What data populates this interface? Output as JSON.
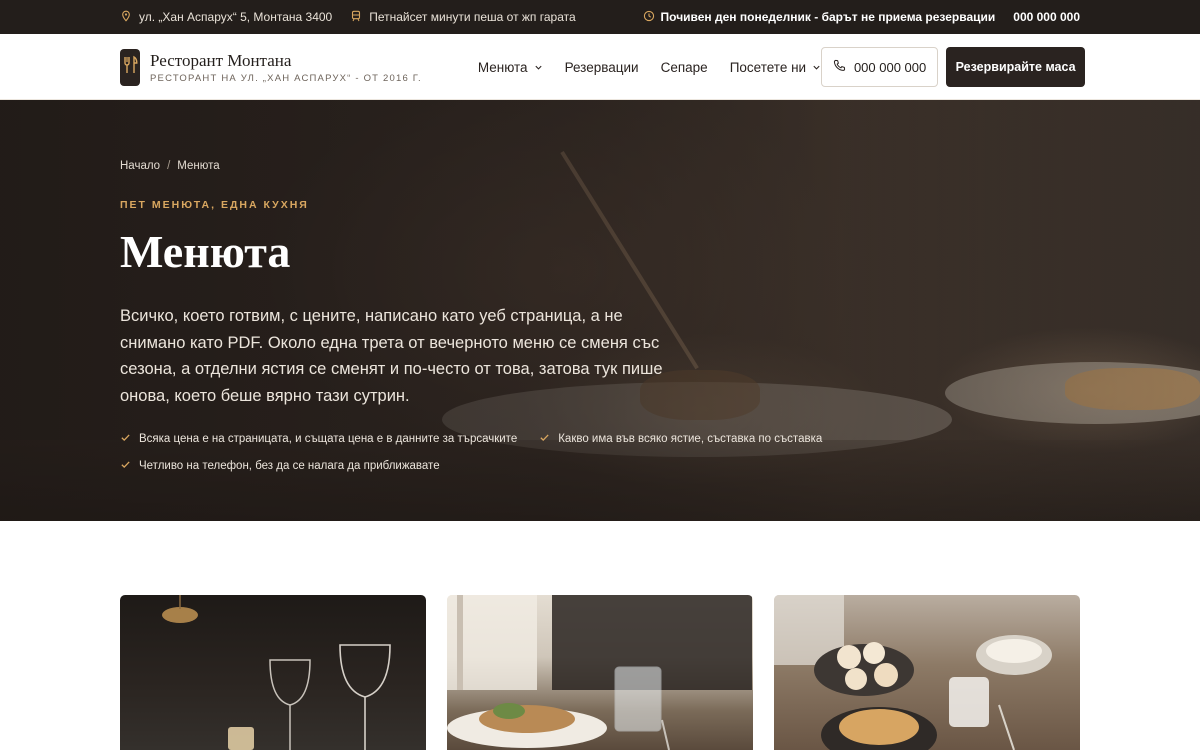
{
  "topbar": {
    "address": "ул. „Хан Аспарух“ 5, Монтана 3400",
    "walk": "Петнайсет минути пеша от жп гарата",
    "notice": "Почивен ден понеделник - барът не приема резервации",
    "phone": "000 000 000"
  },
  "header": {
    "brand_name": "Ресторант Монтана",
    "brand_sub": "РЕСТОРАНТ НА УЛ. „ХАН АСПАРУХ“ - ОТ 2016 Г.",
    "nav": [
      "Менюта",
      "Резервации",
      "Сепаре",
      "Посетете ни"
    ],
    "phone_button": "000 000 000",
    "reserve_button": "Резервирайте маса"
  },
  "hero": {
    "breadcrumb": [
      "Начало",
      "/",
      "Менюта"
    ],
    "eyebrow": "ПЕТ МЕНЮТА, ЕДНА КУХНЯ",
    "title": "Менюта",
    "lead": "Всичко, което готвим, с цените, написано като уеб страница, а не снимано като PDF. Около една трета от вечерното меню се сменя със сезона, а отделни ястия се сменят и по-често от това, затова тук пише онова, което беше вярно тази сутрин.",
    "checks": [
      "Всяка цена е на страницата, и същата цена е в данните за търсачките",
      "Какво има във всяко ястие, съставка по съставка",
      "Четливо на телефон, без да се налага да приближавате"
    ]
  },
  "icons": {
    "address": "map-pin-icon",
    "walk": "train-icon",
    "notice": "clock-icon",
    "phone": "phone-icon",
    "logo": "cutlery-icon",
    "check": "check-icon",
    "dropdown": "chevron-down-icon"
  },
  "colors": {
    "dark": "#2a2320",
    "topbar": "#231e1b",
    "accent": "#d9a760"
  }
}
